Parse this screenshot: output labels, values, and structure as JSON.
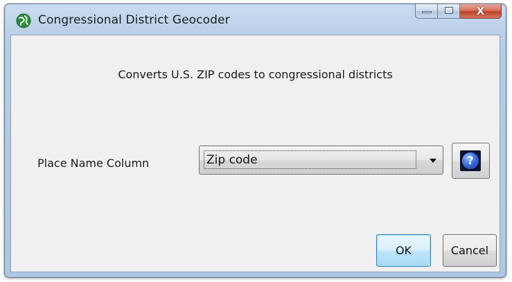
{
  "window": {
    "title": "Congressional District Geocoder",
    "icon": "globe-app-icon",
    "caption_buttons": {
      "minimize_icon": "minimize-icon",
      "maximize_icon": "maximize-icon",
      "close_icon": "close-icon",
      "close_glyph": "X"
    }
  },
  "dialog": {
    "description": "Converts U.S. ZIP codes to congressional districts",
    "field_label": "Place Name Column",
    "combo_value": "Zip code",
    "help_icon": "help-icon",
    "help_glyph": "?",
    "ok_label": "OK",
    "cancel_label": "Cancel"
  },
  "colors": {
    "window_frame": "#b7cde6",
    "client_background": "#f0f0f0",
    "close_button": "#c1402a",
    "default_button_accent": "#3c7fb1"
  }
}
